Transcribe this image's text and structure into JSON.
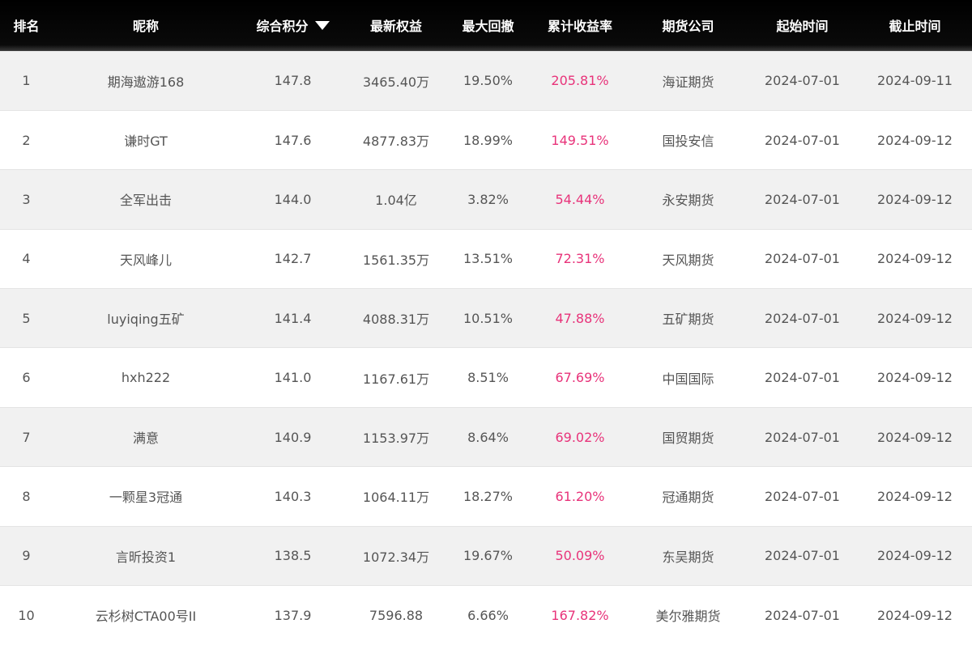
{
  "table": {
    "columns": [
      {
        "key": "rank",
        "label": "排名"
      },
      {
        "key": "nickname",
        "label": "昵称"
      },
      {
        "key": "score",
        "label": "综合积分",
        "sorted": "desc",
        "sort_icon": "sort-down-icon"
      },
      {
        "key": "equity",
        "label": "最新权益"
      },
      {
        "key": "max_drawdown",
        "label": "最大回撤"
      },
      {
        "key": "cum_return",
        "label": "累计收益率"
      },
      {
        "key": "broker",
        "label": "期货公司"
      },
      {
        "key": "start",
        "label": "起始时间"
      },
      {
        "key": "end",
        "label": "截止时间"
      }
    ],
    "rows": [
      {
        "rank": "1",
        "nickname": "期海遨游168",
        "score": "147.8",
        "equity": "3465.40万",
        "max_drawdown": "19.50%",
        "cum_return": "205.81%",
        "broker": "海证期货",
        "start": "2024-07-01",
        "end": "2024-09-11"
      },
      {
        "rank": "2",
        "nickname": "谦时GT",
        "score": "147.6",
        "equity": "4877.83万",
        "max_drawdown": "18.99%",
        "cum_return": "149.51%",
        "broker": "国投安信",
        "start": "2024-07-01",
        "end": "2024-09-12"
      },
      {
        "rank": "3",
        "nickname": "全军出击",
        "score": "144.0",
        "equity": "1.04亿",
        "max_drawdown": "3.82%",
        "cum_return": "54.44%",
        "broker": "永安期货",
        "start": "2024-07-01",
        "end": "2024-09-12"
      },
      {
        "rank": "4",
        "nickname": "天风峰儿",
        "score": "142.7",
        "equity": "1561.35万",
        "max_drawdown": "13.51%",
        "cum_return": "72.31%",
        "broker": "天风期货",
        "start": "2024-07-01",
        "end": "2024-09-12"
      },
      {
        "rank": "5",
        "nickname": "luyiqing五矿",
        "score": "141.4",
        "equity": "4088.31万",
        "max_drawdown": "10.51%",
        "cum_return": "47.88%",
        "broker": "五矿期货",
        "start": "2024-07-01",
        "end": "2024-09-12"
      },
      {
        "rank": "6",
        "nickname": "hxh222",
        "score": "141.0",
        "equity": "1167.61万",
        "max_drawdown": "8.51%",
        "cum_return": "67.69%",
        "broker": "中国国际",
        "start": "2024-07-01",
        "end": "2024-09-12"
      },
      {
        "rank": "7",
        "nickname": "满意",
        "score": "140.9",
        "equity": "1153.97万",
        "max_drawdown": "8.64%",
        "cum_return": "69.02%",
        "broker": "国贸期货",
        "start": "2024-07-01",
        "end": "2024-09-12"
      },
      {
        "rank": "8",
        "nickname": "一颗星3冠通",
        "score": "140.3",
        "equity": "1064.11万",
        "max_drawdown": "18.27%",
        "cum_return": "61.20%",
        "broker": "冠通期货",
        "start": "2024-07-01",
        "end": "2024-09-12"
      },
      {
        "rank": "9",
        "nickname": "言昕投资1",
        "score": "138.5",
        "equity": "1072.34万",
        "max_drawdown": "19.67%",
        "cum_return": "50.09%",
        "broker": "东吴期货",
        "start": "2024-07-01",
        "end": "2024-09-12"
      },
      {
        "rank": "10",
        "nickname": "云杉树CTA00号II",
        "score": "137.9",
        "equity": "7596.88",
        "max_drawdown": "6.66%",
        "cum_return": "167.82%",
        "broker": "美尔雅期货",
        "start": "2024-07-01",
        "end": "2024-09-12"
      }
    ]
  },
  "colors": {
    "header_bg": "#000000",
    "header_text": "#ffffff",
    "row_odd_bg": "#f1f1f1",
    "row_even_bg": "#ffffff",
    "cell_text": "#555555",
    "return_rate": "#e8337a"
  }
}
